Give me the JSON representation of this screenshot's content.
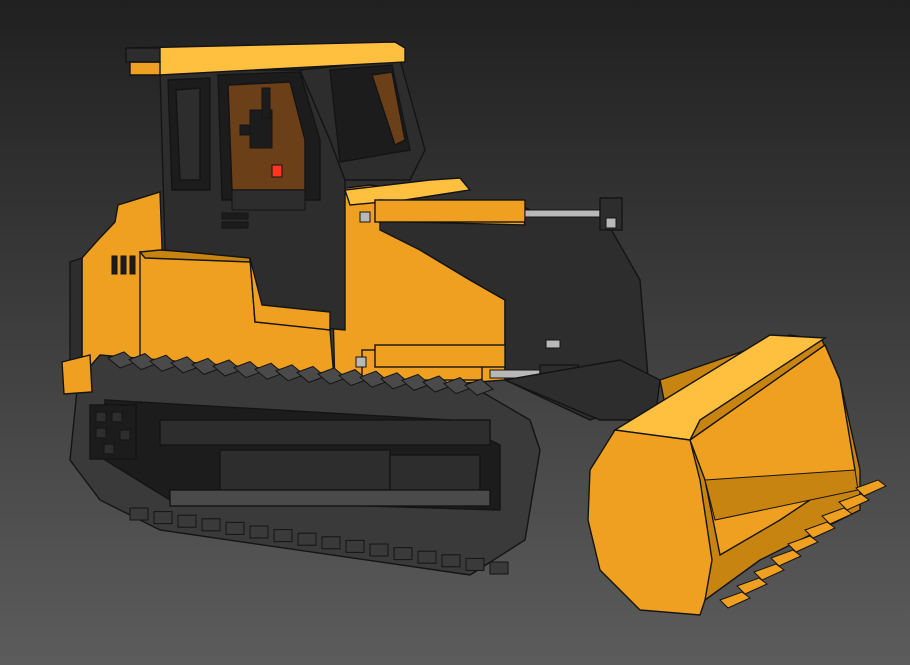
{
  "viewport": {
    "background_top": "#202020",
    "background_bottom": "#5c5c5c"
  },
  "model": {
    "subject": "bulldozer-voxel-model",
    "colors": {
      "body": "#f0a020",
      "body_top": "#ffc040",
      "body_shade": "#c88410",
      "dark": "#2d2d2d",
      "darker": "#1c1c1c",
      "track": "#3a3a3a",
      "track_top": "#4a4a4a",
      "interior": "#6b3f18",
      "light": "#ff3322",
      "rod": "#b8b8b8",
      "outline": "#141414"
    }
  }
}
